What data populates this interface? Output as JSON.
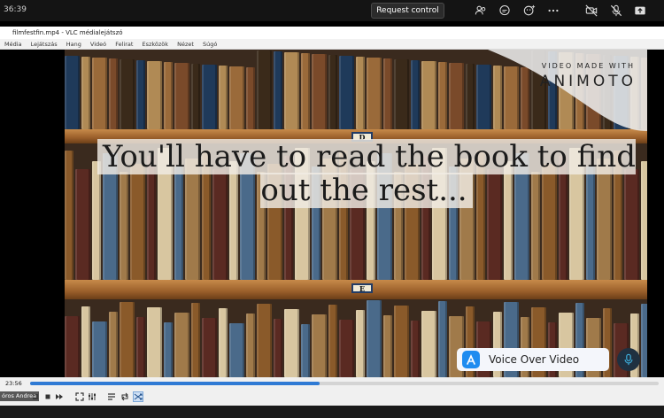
{
  "meeting": {
    "timer": "36:39",
    "request_control_label": "Request control",
    "icons": [
      "people-icon",
      "chat-icon",
      "reactions-icon",
      "more-icon",
      "camera-off-icon",
      "mic-off-icon",
      "share-icon"
    ]
  },
  "vlc": {
    "title": "filmfestfin.mp4 - VLC médialejátszó",
    "menu": [
      "Média",
      "Lejátszás",
      "Hang",
      "Videó",
      "Felirat",
      "Eszközök",
      "Nézet",
      "Súgó"
    ],
    "time_current": "23:56",
    "progress": 0.46
  },
  "video": {
    "caption": "You'll have to read the book to find out the rest...",
    "watermark_small": "VIDEO MADE WITH",
    "watermark_big": "ANIMOTO",
    "plate_top": "D",
    "plate_bottom": "E"
  },
  "overlay": {
    "voice_over_label": "Voice Over Video"
  },
  "participant": {
    "name": "óros Andrea"
  },
  "colors": {
    "seek_fill": "#2f7ad4",
    "teams_bar": "#141414"
  }
}
